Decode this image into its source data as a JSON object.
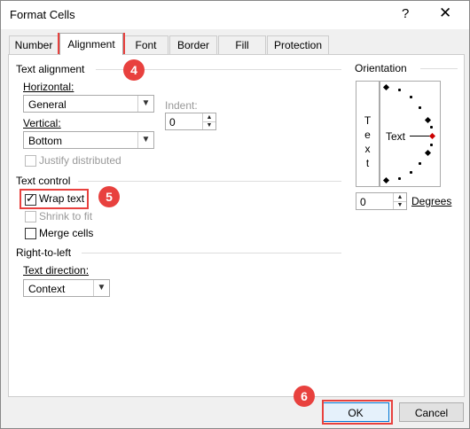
{
  "window": {
    "title": "Format Cells",
    "help": "?",
    "close": "✕"
  },
  "tabs": [
    {
      "label": "Number"
    },
    {
      "label": "Alignment"
    },
    {
      "label": "Font"
    },
    {
      "label": "Border"
    },
    {
      "label": "Fill"
    },
    {
      "label": "Protection"
    }
  ],
  "text_alignment": {
    "heading": "Text alignment",
    "horizontal_label": "Horizontal:",
    "horizontal_value": "General",
    "vertical_label": "Vertical:",
    "vertical_value": "Bottom",
    "indent_label": "Indent:",
    "indent_value": "0",
    "justify_distributed": "Justify distributed"
  },
  "text_control": {
    "heading": "Text control",
    "wrap_text": "Wrap text",
    "wrap_checked": true,
    "shrink_to_fit": "Shrink to fit",
    "merge_cells": "Merge cells"
  },
  "rtl": {
    "heading": "Right-to-left",
    "direction_label": "Text direction:",
    "direction_value": "Context"
  },
  "orientation": {
    "heading": "Orientation",
    "vertical_letters": [
      "T",
      "e",
      "x",
      "t"
    ],
    "dial_label": "Text",
    "degrees_value": "0",
    "degrees_label": "Degrees"
  },
  "buttons": {
    "ok": "OK",
    "cancel": "Cancel"
  },
  "callouts": {
    "c4": "4",
    "c5": "5",
    "c6": "6"
  },
  "colors": {
    "callout": "#e8413e",
    "accent": "#0078d7"
  }
}
